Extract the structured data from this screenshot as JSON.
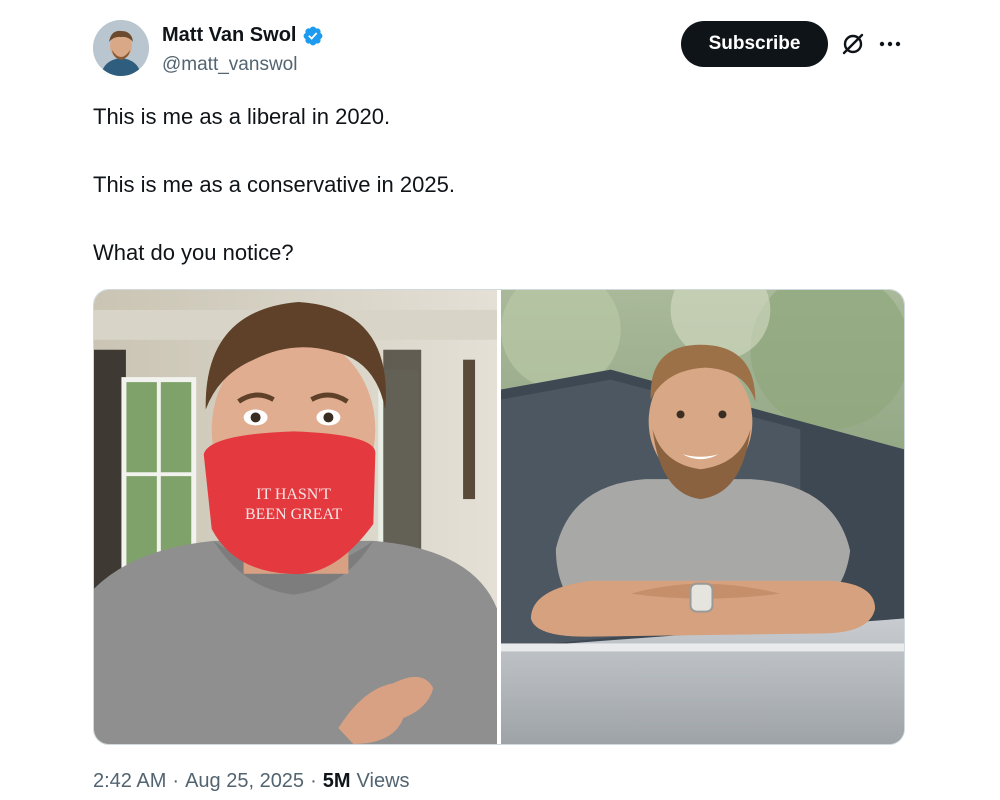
{
  "author": {
    "display_name": "Matt Van Swol",
    "handle": "@matt_vanswol",
    "verified": true,
    "verified_color": "#1d9bf0"
  },
  "actions": {
    "subscribe_label": "Subscribe",
    "grok_icon": "grok-icon",
    "more_icon": "more-icon"
  },
  "tweet": {
    "lines": [
      "This is me as a liberal in 2020.",
      "This is me as a conservative in 2025.",
      "What do you notice?"
    ],
    "media": [
      {
        "mask_text_line1": "IT HASN'T",
        "mask_text_line2": "BEEN GREAT"
      },
      {
        "mask_text_line1": "",
        "mask_text_line2": ""
      }
    ]
  },
  "meta": {
    "time": "2:42 AM",
    "sep1": "·",
    "date": "Aug 25, 2025",
    "sep2": "·",
    "views_count": "5M",
    "views_label": "Views"
  }
}
